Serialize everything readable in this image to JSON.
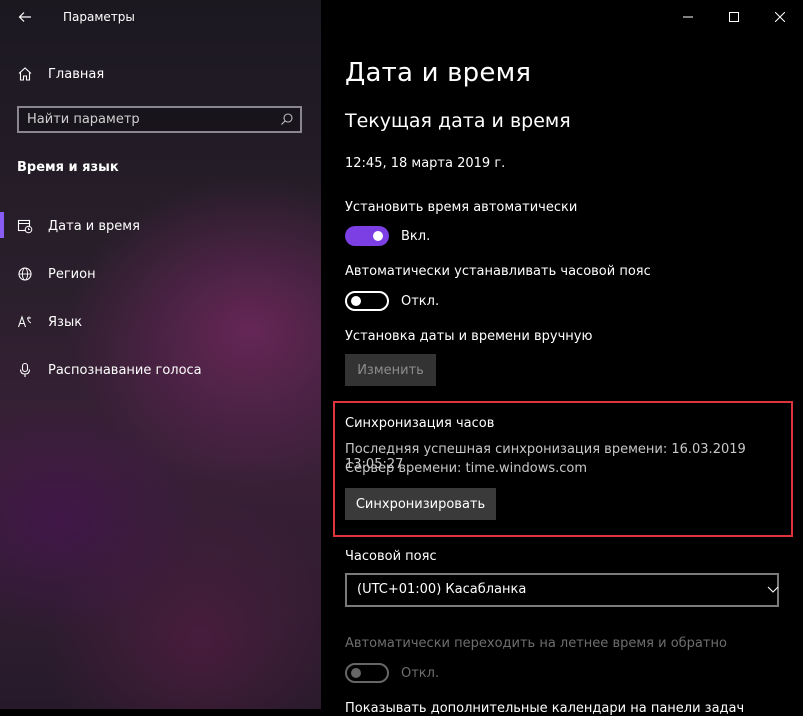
{
  "app": {
    "title": "Параметры"
  },
  "sidebar": {
    "home_label": "Главная",
    "search": {
      "placeholder": "Найти параметр"
    },
    "section_heading": "Время и язык",
    "items": [
      {
        "label": "Дата и время",
        "icon": "calendar-clock-icon",
        "active": true
      },
      {
        "label": "Регион",
        "icon": "globe-icon",
        "active": false
      },
      {
        "label": "Язык",
        "icon": "language-icon",
        "active": false
      },
      {
        "label": "Распознавание голоса",
        "icon": "microphone-icon",
        "active": false
      }
    ]
  },
  "main": {
    "title": "Дата и время",
    "current_heading": "Текущая дата и время",
    "current_datetime": "12:45, 18 марта 2019 г.",
    "auto_time": {
      "label": "Установить время автоматически",
      "state": "Вкл.",
      "on": true
    },
    "auto_timezone": {
      "label": "Автоматически устанавливать часовой пояс",
      "state": "Откл.",
      "on": false
    },
    "manual": {
      "label": "Установка даты и времени вручную",
      "button": "Изменить"
    },
    "sync": {
      "heading": "Синхронизация часов",
      "last_sync": "Последняя успешная синхронизация времени: 16.03.2019 13:05:27",
      "server": "Сервер времени: time.windows.com",
      "button": "Синхронизировать"
    },
    "timezone": {
      "label": "Часовой пояс",
      "value": "(UTC+01:00) Касабланка"
    },
    "dst": {
      "label": "Автоматически переходить на летнее время и обратно",
      "state": "Откл.",
      "on": false,
      "disabled": true
    },
    "next_partial": "Показывать дополнительные календари на панели задач"
  },
  "colors": {
    "accent": "#7b3fe4",
    "highlight_frame": "#e0343d",
    "active_indicator": "#8a5cf6"
  }
}
